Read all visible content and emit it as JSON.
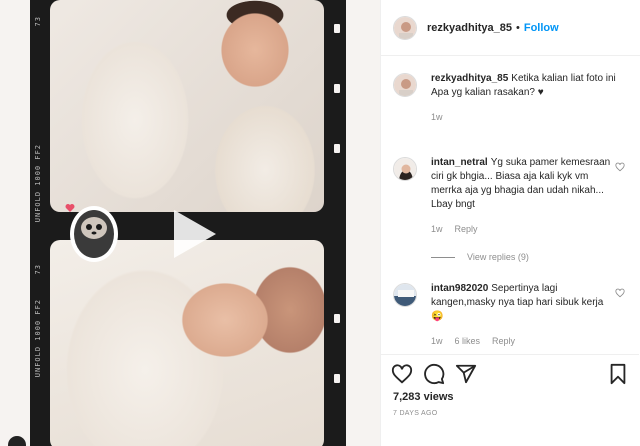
{
  "media": {
    "film_text_top": "73",
    "film_text_mid": "UNFOLD 1000 FF2",
    "film_text_bottom": "UNFOLD 1000 FF2",
    "film_text_num": "73",
    "play_icon": "play-icon",
    "sticker_icon": "sloth-sticker-icon"
  },
  "header": {
    "username": "rezkyadhitya_85",
    "separator": "•",
    "follow_label": "Follow"
  },
  "caption": {
    "username": "rezkyadhitya_85",
    "text": "Ketika kalian liat foto ini\nApa yg kalian rasakan? ♥",
    "time": "1w"
  },
  "comments": [
    {
      "username": "intan_netral",
      "text": "Yg suka pamer kemesraan ciri gk bhgia... Biasa aja kali kyk vm merrka aja yg bhagia dan udah nikah... Lbay bngt",
      "time": "1w",
      "reply_label": "Reply"
    },
    {
      "username": "intan982020",
      "text": "Sepertinya lagi kangen,masky nya tiap hari sibuk kerja😜",
      "time": "1w",
      "likes": "6 likes",
      "reply_label": "Reply"
    }
  ],
  "view_replies": "View replies (9)",
  "actions": {
    "icons": [
      "heart-icon",
      "comment-icon",
      "share-icon",
      "bookmark-icon"
    ],
    "views": "7,283 views",
    "date": "7 DAYS AGO"
  },
  "colors": {
    "link": "#0095f6",
    "muted": "#8e8e8e",
    "text": "#262626"
  }
}
